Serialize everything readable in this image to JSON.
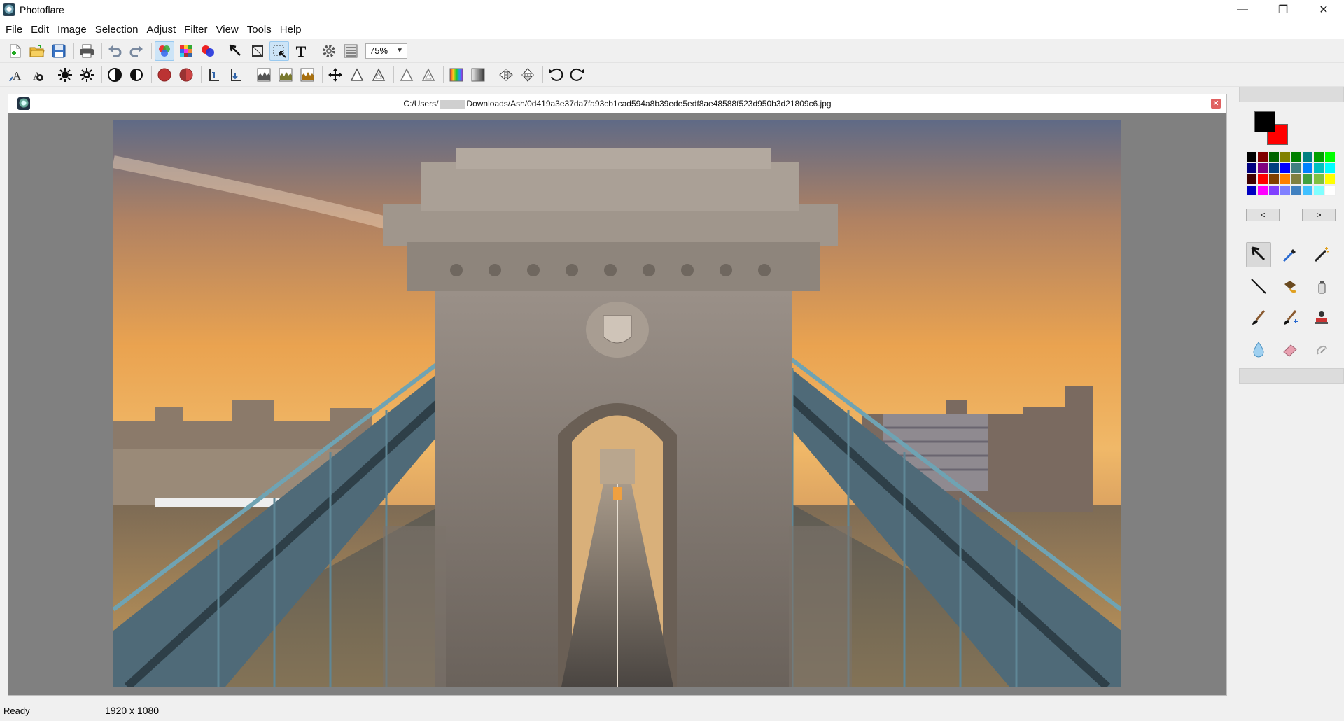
{
  "window": {
    "title": "Photoflare",
    "minimize_glyph": "—",
    "maximize_glyph": "❐",
    "close_glyph": "✕"
  },
  "menu": [
    "File",
    "Edit",
    "Image",
    "Selection",
    "Adjust",
    "Filter",
    "View",
    "Tools",
    "Help"
  ],
  "toolbar": {
    "zoom_value": "75%",
    "row1_icons": [
      "new-file-icon",
      "open-folder-icon",
      "save-icon",
      "print-icon",
      "undo-icon",
      "redo-icon",
      "color-balance-icon",
      "mosaic-icon",
      "rgb-circles-icon",
      "pointer-tool-icon",
      "crop-tool-icon",
      "selection-tool-icon",
      "text-tool-icon",
      "settings-icon",
      "layers-list-icon"
    ],
    "row2_icons": [
      "auto-levels-icon",
      "auto-contrast-icon",
      "brightness-icon",
      "brightness-alt-icon",
      "contrast-icon",
      "contrast-alt-icon",
      "saturation-icon",
      "saturation-alt-icon",
      "gamma-icon",
      "gamma-alt-icon",
      "histogram-icon",
      "histogram-green-icon",
      "histogram-yellow-icon",
      "move-icon",
      "sharpen-icon",
      "sharpen-alt-icon",
      "blur-icon",
      "blur-alt-icon",
      "rainbow-gradient-icon",
      "grayscale-gradient-icon",
      "flip-horizontal-icon",
      "flip-vertical-icon",
      "rotate-left-icon",
      "rotate-right-icon"
    ]
  },
  "document": {
    "path_prefix": "C:/Users/",
    "path_suffix": "Downloads/Ash/0d419a3e37da7fa93cb1cad594a8b39ede5edf8ae48588f523d950b3d21809c6.jpg",
    "close_glyph": "✕"
  },
  "palette": {
    "foreground": "#000000",
    "background": "#ff0000",
    "prev_label": "<",
    "next_label": ">",
    "colors": [
      "#000000",
      "#800000",
      "#006400",
      "#808000",
      "#008000",
      "#008080",
      "#00a000",
      "#00ff00",
      "#000080",
      "#800080",
      "#004080",
      "#0000ff",
      "#408080",
      "#0080ff",
      "#00c0c0",
      "#00ffff",
      "#400000",
      "#ff0000",
      "#804000",
      "#ff8000",
      "#808040",
      "#40a040",
      "#80c040",
      "#ffff00",
      "#0000c0",
      "#ff00ff",
      "#8040ff",
      "#8080ff",
      "#4080c0",
      "#40c0ff",
      "#80ffff",
      "#ffffff"
    ]
  },
  "tools": [
    "pointer-icon",
    "color-picker-icon",
    "magic-wand-icon",
    "line-icon",
    "paint-bucket-icon",
    "spray-can-icon",
    "paintbrush-icon",
    "paintbrush-plus-icon",
    "stamp-icon",
    "blur-drop-icon",
    "eraser-icon",
    "smudge-icon"
  ],
  "status": {
    "state": "Ready",
    "dimensions": "1920 x 1080"
  }
}
